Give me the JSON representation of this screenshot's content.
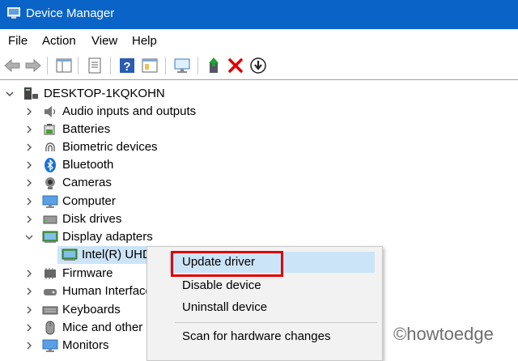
{
  "window": {
    "title": "Device Manager"
  },
  "menu": [
    "File",
    "Action",
    "View",
    "Help"
  ],
  "toolbar": {
    "buttons": [
      "back-icon",
      "forward-icon",
      "properties-panel-icon",
      "properties-sheet-icon",
      "help-icon",
      "console-tree-icon",
      "computer-display-icon",
      "update-driver-icon",
      "uninstall-icon",
      "scan-hardware-icon"
    ]
  },
  "tree": {
    "root": "DESKTOP-1KQKOHN",
    "items": [
      {
        "label": "Audio inputs and outputs",
        "icon": "speaker-icon",
        "expanded": false
      },
      {
        "label": "Batteries",
        "icon": "battery-icon",
        "expanded": false
      },
      {
        "label": "Biometric devices",
        "icon": "fingerprint-icon",
        "expanded": false
      },
      {
        "label": "Bluetooth",
        "icon": "bluetooth-icon",
        "expanded": false
      },
      {
        "label": "Cameras",
        "icon": "camera-icon",
        "expanded": false
      },
      {
        "label": "Computer",
        "icon": "monitor-icon",
        "expanded": false
      },
      {
        "label": "Disk drives",
        "icon": "disk-icon",
        "expanded": false
      },
      {
        "label": "Display adapters",
        "icon": "display-adapter-icon",
        "expanded": true
      },
      {
        "label": "Intel(R) UHD",
        "icon": "display-adapter-icon",
        "child": true,
        "selected": true
      },
      {
        "label": "Firmware",
        "icon": "chip-icon",
        "expanded": false
      },
      {
        "label": "Human Interface",
        "icon": "hid-icon",
        "expanded": false
      },
      {
        "label": "Keyboards",
        "icon": "keyboard-icon",
        "expanded": false
      },
      {
        "label": "Mice and other p",
        "icon": "mouse-icon",
        "expanded": false
      },
      {
        "label": "Monitors",
        "icon": "monitor-icon",
        "expanded": false
      }
    ]
  },
  "context_menu": {
    "items": [
      {
        "label": "Update driver",
        "highlighted": true
      },
      {
        "label": "Disable device"
      },
      {
        "label": "Uninstall device"
      },
      {
        "label": "Scan for hardware changes"
      }
    ]
  },
  "watermark": "©howtoedge",
  "colors": {
    "titlebar": "#0a64c8",
    "highlight": "#cce4f7",
    "callout": "#e00000"
  }
}
